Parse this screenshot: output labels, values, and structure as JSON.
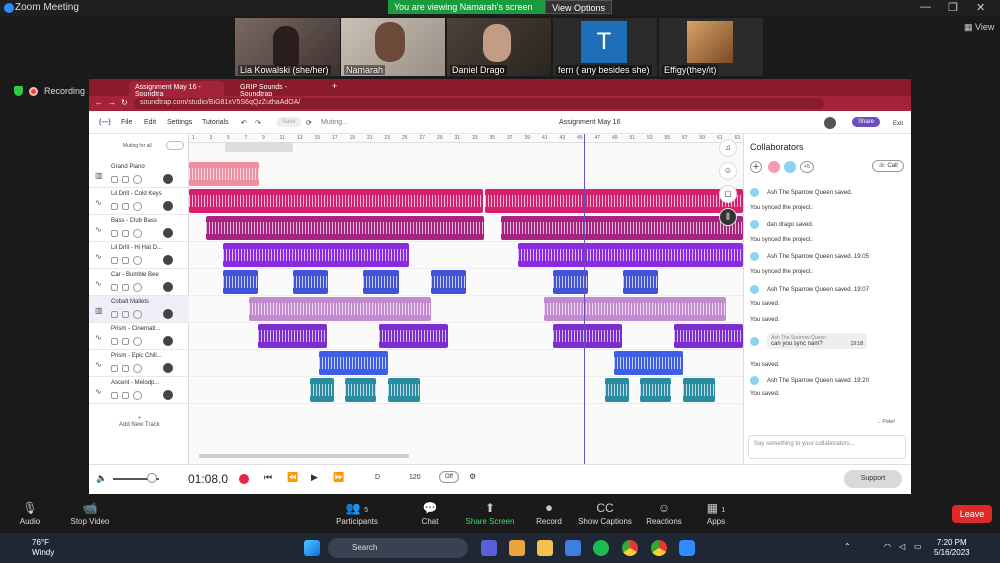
{
  "zoom": {
    "window_title": "Zoom Meeting",
    "share_banner": "You are viewing Namarah's screen",
    "view_options": "View Options",
    "view_label": "View",
    "recording": "Recording",
    "participants": [
      {
        "name": "Lia Kowalski (she/her)"
      },
      {
        "name": "Namarah"
      },
      {
        "name": "Daniel Drago"
      },
      {
        "name": "fern ( any besides she)",
        "initial": "T"
      },
      {
        "name": "Effigy(they/it)"
      }
    ],
    "toolbar": [
      {
        "label": "Audio",
        "icon": "microphone-icon"
      },
      {
        "label": "Stop Video",
        "icon": "camera-icon"
      },
      {
        "label": "Participants",
        "icon": "participants-icon",
        "count": "5"
      },
      {
        "label": "Chat",
        "icon": "chat-icon"
      },
      {
        "label": "Share Screen",
        "icon": "share-screen-icon"
      },
      {
        "label": "Record",
        "icon": "record-icon"
      },
      {
        "label": "Show Captions",
        "icon": "captions-icon",
        "glyph": "CC"
      },
      {
        "label": "Reactions",
        "icon": "reactions-icon"
      },
      {
        "label": "Apps",
        "icon": "apps-icon",
        "count": "1"
      }
    ],
    "leave": "Leave",
    "audio_badge": "1"
  },
  "browser": {
    "tabs": [
      {
        "title": "Assignment May 16 - Soundtra",
        "active": true
      },
      {
        "title": "GRIP Sounds - Soundtrap",
        "active": false
      }
    ],
    "url": "soundtrap.com/studio/BiG81xV5S6qQzZuthaAdOA/"
  },
  "studio": {
    "menu": [
      "File",
      "Edit",
      "Settings",
      "Tutorials"
    ],
    "save": "Save",
    "status": "Muting...",
    "project_title": "Assignment May 16",
    "share": "Share",
    "exit": "Exit",
    "muting_for_all": "Muting for all",
    "ruler": [
      "1",
      "3",
      "5",
      "7",
      "9",
      "11",
      "13",
      "15",
      "17",
      "19",
      "21",
      "23",
      "25",
      "27",
      "29",
      "31",
      "33",
      "35",
      "37",
      "39",
      "41",
      "43",
      "45",
      "47",
      "49",
      "51",
      "53",
      "55",
      "57",
      "59",
      "61",
      "63"
    ],
    "tracks": [
      {
        "name": "Grand Piano",
        "color": "#f08fa0"
      },
      {
        "name": "Lil Drill - Cold Keys",
        "color": "#d4206e"
      },
      {
        "name": "Bass - Club Bass",
        "color": "#a6237f"
      },
      {
        "name": "Lil Drill - Hi Hat D...",
        "color": "#8a2be2"
      },
      {
        "name": "Car - Bumble Bee",
        "color": "#4052d6"
      },
      {
        "name": "Cobalt Mallets",
        "color": "#c28bd0"
      },
      {
        "name": "Prism - Cinemati...",
        "color": "#7b2fd1"
      },
      {
        "name": "Prism - Epic Chill...",
        "color": "#3d5ee6"
      },
      {
        "name": "Ascent - Melodp...",
        "color": "#2a8ca0"
      }
    ],
    "add_track": "Add New Track",
    "loop_buttons": [
      "Browse loops",
      "Patterns Beatmaker",
      "Play the synth"
    ],
    "timecode": "01:08.0",
    "key": "D",
    "tempo": "120",
    "metronome": "Off",
    "support": "Support"
  },
  "collaborators": {
    "title": "Collaborators",
    "more_count": "+5",
    "call": "Call",
    "messages": [
      {
        "text": "Ash The Sparrow Queen saved.",
        "avatar": true
      },
      {
        "text": "You synced the project.",
        "avatar": false
      },
      {
        "text": "dan drago saved.",
        "avatar": true
      },
      {
        "text": "You synced the project.",
        "avatar": false
      },
      {
        "text": "Ash The Sparrow Queen saved. 19:05",
        "avatar": true
      },
      {
        "text": "You synced the project.",
        "avatar": false
      },
      {
        "text": "Ash The Sparrow Queen saved. 19:07",
        "avatar": true
      },
      {
        "text": "You saved.",
        "avatar": false
      },
      {
        "text": "You saved.",
        "avatar": false
      },
      {
        "text": "Ash The Sparrow Queen",
        "avatar": true,
        "bubble": "can you sync nam?",
        "time": "19:18"
      },
      {
        "text": "You saved.",
        "avatar": false
      },
      {
        "text": "Ash The Sparrow Queen saved. 19:20",
        "avatar": true
      },
      {
        "text": "You saved.",
        "avatar": false
      }
    ],
    "poke": "Poke!",
    "input_placeholder": "Say something to your collaborators..."
  },
  "taskbar": {
    "weather_temp": "76°F",
    "weather_desc": "Windy",
    "search": "Search",
    "time": "7:20 PM",
    "date": "5/16/2023"
  }
}
